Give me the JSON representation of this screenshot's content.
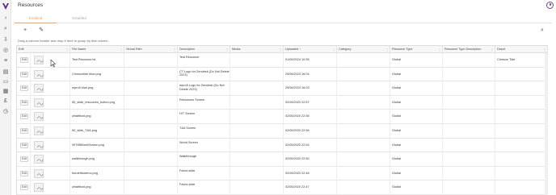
{
  "app": {
    "title": "Resources",
    "brand_color": "#5a2d82",
    "accent_color": "#f0a060"
  },
  "tabs": [
    {
      "label": "Enabled",
      "active": true
    },
    {
      "label": "Disabled",
      "active": false
    }
  ],
  "toolbar": {
    "add_icon": "plus-icon",
    "edit_icon": "edit-icon",
    "search_icon": "search-icon"
  },
  "grid": {
    "group_hint": "Drag a column header and drop it here to group by that column",
    "columns": [
      "Edit",
      "File Name",
      "Virtual Path",
      "Description",
      "Media",
      "Uploaded",
      "Category",
      "Resource Type",
      "Resource Type Description",
      "Depot"
    ],
    "sort": {
      "column": "Uploaded",
      "direction": "asc"
    },
    "edit_label": "Edit",
    "rows": [
      {
        "file": "Test Resource.txt",
        "virtual": "",
        "description": "Test Resource",
        "media": "",
        "uploaded": "01/05/2024 10:55",
        "category": "",
        "type": "Global",
        "type_desc": "",
        "depot": "Crimson Tide"
      },
      {
        "file": "Crimsontide blue.png",
        "virtual": "",
        "description": "CT Logo for Zendesk (Do Not Delete 2023)",
        "media": "",
        "uploaded": "29/06/2023 16:04",
        "category": "",
        "type": "Global",
        "type_desc": "",
        "depot": ""
      },
      {
        "file": "mpro5 blue.png",
        "virtual": "",
        "description": "mpro5 Logo for Zendesk (Do Not Delete 2023)",
        "media": "",
        "uploaded": "29/06/2023 16:03",
        "category": "",
        "type": "Global",
        "type_desc": "",
        "depot": ""
      },
      {
        "file": "50_slide_resources_button.png",
        "virtual": "",
        "description": "Resources Screen",
        "media": "",
        "uploaded": "02/05/2020 22:57",
        "category": "",
        "type": "Global",
        "type_desc": "",
        "depot": ""
      },
      {
        "file": "whatitsnd.png",
        "virtual": "",
        "description": "H/T Screen",
        "media": "",
        "uploaded": "02/05/2020 22:56",
        "category": "",
        "type": "Global",
        "type_desc": "",
        "depot": ""
      },
      {
        "file": "50_slide_T&A.png",
        "virtual": "",
        "description": "T&A Screen",
        "media": "",
        "uploaded": "02/05/2020 22:56",
        "category": "",
        "type": "Global",
        "type_desc": "",
        "depot": ""
      },
      {
        "file": "09798WorldScreen.png",
        "virtual": "",
        "description": "World Screen",
        "media": "",
        "uploaded": "02/05/2020 22:54",
        "category": "",
        "type": "Global",
        "type_desc": "",
        "depot": ""
      },
      {
        "file": "walkthrough.png",
        "virtual": "",
        "description": "Walkthrough",
        "media": "",
        "uploaded": "02/05/2020 22:50",
        "category": "",
        "type": "Global",
        "type_desc": "",
        "depot": ""
      },
      {
        "file": "borderfootemc.png",
        "virtual": "",
        "description": "Faves slide",
        "media": "",
        "uploaded": "02/05/2020 22:48",
        "category": "",
        "type": "Global",
        "type_desc": "",
        "depot": ""
      },
      {
        "file": "whatitsnd.png",
        "virtual": "",
        "description": "Faves slide",
        "media": "",
        "uploaded": "02/05/2020 22:47",
        "category": "",
        "type": "Global",
        "type_desc": "",
        "depot": ""
      }
    ]
  },
  "rail_icons": [
    "chevron-right-icon",
    "search-icon",
    "upload-icon",
    "settings-icon",
    "list-icon",
    "document-icon",
    "monitor-icon",
    "report-icon",
    "currency-icon",
    "clock-icon"
  ]
}
